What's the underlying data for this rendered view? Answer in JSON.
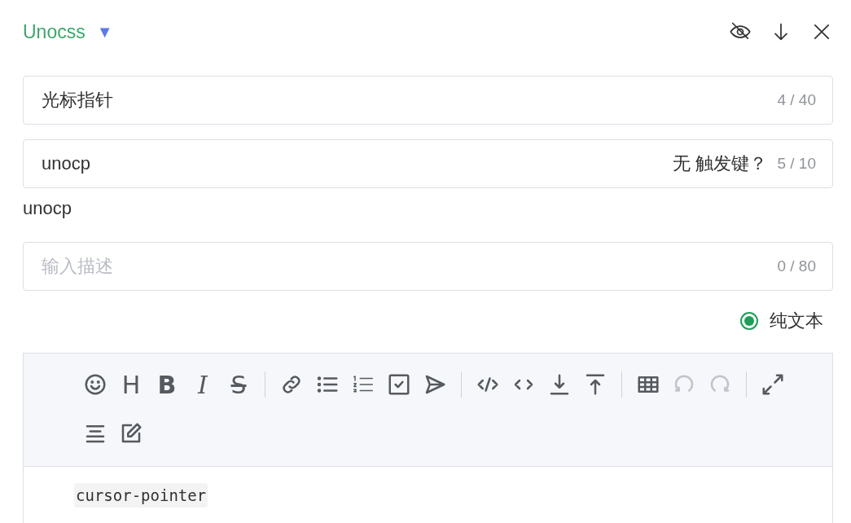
{
  "header": {
    "title": "Unocss",
    "dropdown": "▼"
  },
  "fields": [
    {
      "value": "光标指针",
      "count": "4 / 40"
    },
    {
      "value": "unocp",
      "suffix": "无 触发键？",
      "count": "5 / 10"
    }
  ],
  "preview": "unocp",
  "description": {
    "placeholder": "输入描述",
    "count": "0 / 80"
  },
  "radio": {
    "label": "纯文本",
    "selected": true
  },
  "toolbar": {
    "rows": [
      [
        [
          {
            "kind": "emoji",
            "disabled": false
          },
          {
            "kind": "heading",
            "glyph": "H",
            "disabled": false
          },
          {
            "kind": "bold",
            "glyph": "B",
            "disabled": false
          },
          {
            "kind": "italic",
            "glyph": "I",
            "disabled": false
          },
          {
            "kind": "strike",
            "glyph": "S",
            "disabled": false
          }
        ],
        [
          {
            "kind": "link",
            "disabled": false
          },
          {
            "kind": "bullet-list",
            "disabled": false
          },
          {
            "kind": "numbered-list",
            "disabled": false
          },
          {
            "kind": "checkbox",
            "disabled": false
          },
          {
            "kind": "send",
            "disabled": false
          }
        ],
        [
          {
            "kind": "code-block",
            "disabled": false
          },
          {
            "kind": "code-inline",
            "disabled": false
          },
          {
            "kind": "arrow-down-line",
            "disabled": false
          },
          {
            "kind": "arrow-up-line",
            "disabled": false
          }
        ],
        [
          {
            "kind": "table",
            "disabled": false
          },
          {
            "kind": "undo",
            "disabled": true
          },
          {
            "kind": "redo",
            "disabled": true
          }
        ],
        [
          {
            "kind": "expand",
            "disabled": false
          }
        ]
      ],
      [
        [
          {
            "kind": "align-center",
            "disabled": false
          },
          {
            "kind": "edit",
            "disabled": false
          }
        ]
      ]
    ]
  },
  "content": {
    "code": "cursor-pointer"
  }
}
